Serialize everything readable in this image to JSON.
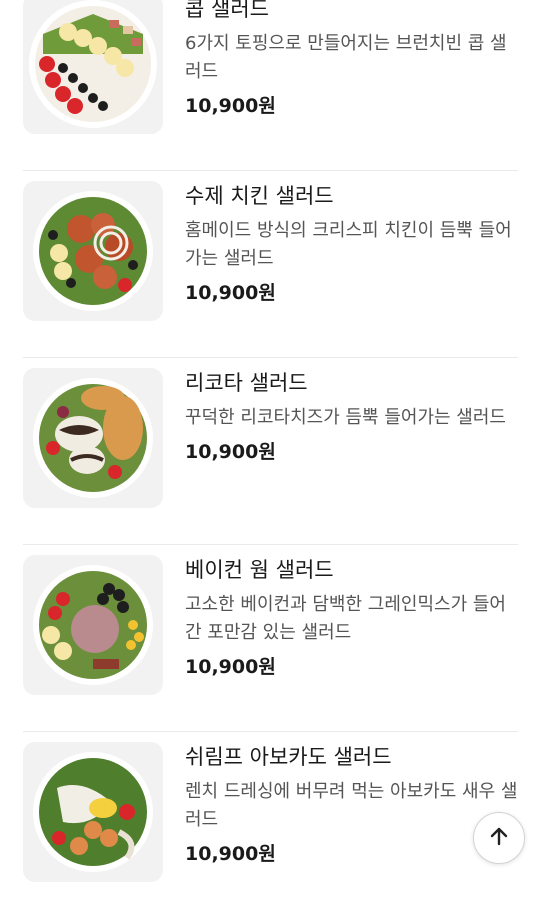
{
  "menu_items": [
    {
      "name": "콥 샐러드",
      "description": "6가지 토핑으로 만들어지는 브런치빈 콥 샐러드",
      "price": "10,900원",
      "image": "cobb-salad-photo"
    },
    {
      "name": "수제 치킨 샐러드",
      "description": "홈메이드 방식의 크리스피 치킨이 듬뿍 들어가는 샐러드",
      "price": "10,900원",
      "image": "chicken-salad-photo"
    },
    {
      "name": "리코타 샐러드",
      "description": "꾸덕한 리코타치즈가 듬뿍 들어가는 샐러드",
      "price": "10,900원",
      "image": "ricotta-salad-photo"
    },
    {
      "name": "베이컨 웜 샐러드",
      "description": "고소한 베이컨과 담백한 그레인믹스가 들어간 포만감 있는 샐러드",
      "price": "10,900원",
      "image": "bacon-warm-salad-photo"
    },
    {
      "name": "쉬림프 아보카도 샐러드",
      "description": "렌치 드레싱에 버무려 먹는 아보카도 새우 샐러드",
      "price": "10,900원",
      "image": "shrimp-avocado-salad-photo"
    }
  ],
  "scroll_top_button": {
    "icon": "arrow-up-icon"
  },
  "colors": {
    "text_primary": "#1a1a1a",
    "text_secondary": "#555555",
    "divider": "#eaeaea",
    "thumb_bg": "#f2f2f2"
  }
}
